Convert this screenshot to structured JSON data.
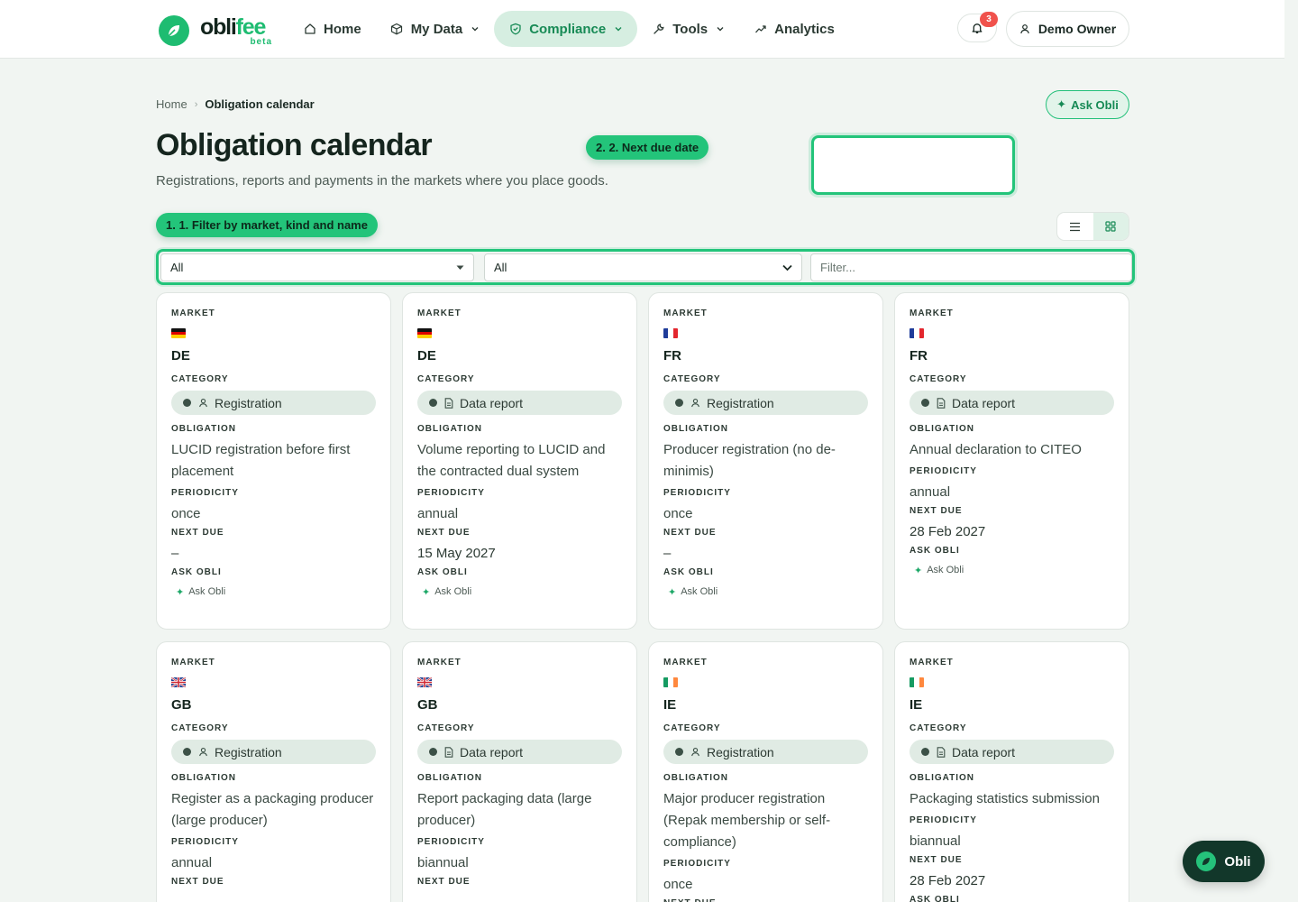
{
  "brand": {
    "name_dark": "obli",
    "name_accent": "fee",
    "tag": "beta"
  },
  "nav": [
    {
      "label": "Home",
      "icon": "home-icon",
      "has_menu": false,
      "active": false
    },
    {
      "label": "My Data",
      "icon": "box-icon",
      "has_menu": true,
      "active": false
    },
    {
      "label": "Compliance",
      "icon": "shield-icon",
      "has_menu": true,
      "active": true
    },
    {
      "label": "Tools",
      "icon": "wrench-icon",
      "has_menu": true,
      "active": false
    },
    {
      "label": "Analytics",
      "icon": "trend-icon",
      "has_menu": false,
      "active": false
    }
  ],
  "notifications": {
    "count": "3"
  },
  "user": {
    "name": "Demo Owner"
  },
  "breadcrumb": {
    "home": "Home",
    "separator": "›",
    "current": "Obligation calendar"
  },
  "ask_button": {
    "label": "Ask Obli"
  },
  "page": {
    "title": "Obligation calendar",
    "subtitle": "Registrations, reports and payments in the markets where you place goods."
  },
  "tour": {
    "filter_step": "1. 1. Filter by market, kind and name",
    "next_due_step": "2. 2. Next due date"
  },
  "filters": {
    "market_value": "All",
    "kind_value": "All",
    "name_placeholder": "Filter..."
  },
  "card_labels": {
    "market": "MARKET",
    "category": "CATEGORY",
    "obligation": "OBLIGATION",
    "periodicity": "PERIODICITY",
    "next_due": "NEXT DUE",
    "ask_obli": "ASK OBLI",
    "ask_link": "Ask Obli"
  },
  "cards": [
    {
      "market": "DE",
      "flag": "de",
      "category": "Registration",
      "category_icon": "user-icon",
      "obligation": "LUCID registration before first placement",
      "periodicity": "once",
      "next_due": "–"
    },
    {
      "market": "DE",
      "flag": "de",
      "category": "Data report",
      "category_icon": "document-icon",
      "obligation": "Volume reporting to LUCID and the contracted dual system",
      "periodicity": "annual",
      "next_due": "15 May 2027"
    },
    {
      "market": "FR",
      "flag": "fr",
      "category": "Registration",
      "category_icon": "user-icon",
      "obligation": "Producer registration (no de-minimis)",
      "periodicity": "once",
      "next_due": "–"
    },
    {
      "market": "FR",
      "flag": "fr",
      "category": "Data report",
      "category_icon": "document-icon",
      "obligation": "Annual declaration to CITEO",
      "periodicity": "annual",
      "next_due": "28 Feb 2027"
    },
    {
      "market": "GB",
      "flag": "gb",
      "category": "Registration",
      "category_icon": "user-icon",
      "obligation": "Register as a packaging producer (large producer)",
      "periodicity": "annual",
      "next_due": ""
    },
    {
      "market": "GB",
      "flag": "gb",
      "category": "Data report",
      "category_icon": "document-icon",
      "obligation": "Report packaging data (large producer)",
      "periodicity": "biannual",
      "next_due": ""
    },
    {
      "market": "IE",
      "flag": "ie",
      "category": "Registration",
      "category_icon": "user-icon",
      "obligation": "Major producer registration (Repak membership or self-compliance)",
      "periodicity": "once",
      "next_due": ""
    },
    {
      "market": "IE",
      "flag": "ie",
      "category": "Data report",
      "category_icon": "document-icon",
      "obligation": "Packaging statistics submission",
      "periodicity": "biannual",
      "next_due": "28 Feb 2027"
    }
  ],
  "fab": {
    "label": "Obli"
  },
  "colors": {
    "accent": "#23c47a",
    "accent_dark": "#178a55",
    "fab_bg": "#12372a",
    "badge": "#f0524c"
  }
}
